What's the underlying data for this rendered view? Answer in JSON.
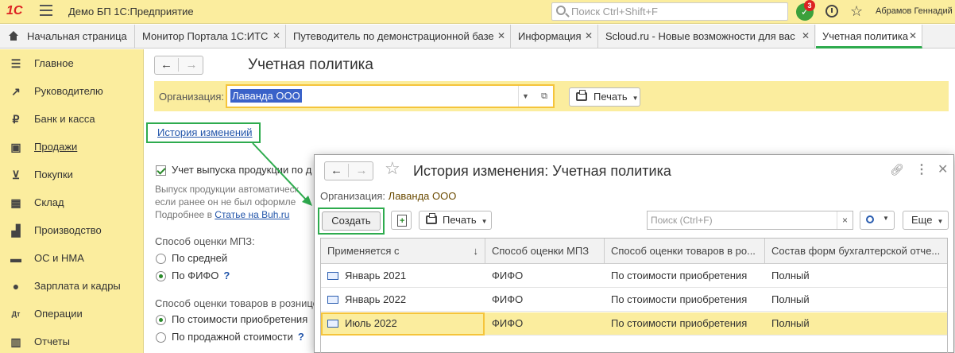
{
  "topbar": {
    "logo": "1С",
    "title": "Демо БП 1С:Предприятие",
    "search_placeholder": "Поиск Ctrl+Shift+F",
    "notif_count": "3",
    "user": "Абрамов Геннадий"
  },
  "tabs": [
    {
      "label": "Начальная страница"
    },
    {
      "label": "Монитор Портала 1С:ИТС"
    },
    {
      "label": "Путеводитель по демонстрационной базе"
    },
    {
      "label": "Информация"
    },
    {
      "label": "Scloud.ru - Новые возможности для вас"
    },
    {
      "label": "Учетная политика"
    }
  ],
  "sidebar": {
    "items": [
      {
        "label": "Главное",
        "icon": "menu-icon"
      },
      {
        "label": "Руководителю",
        "icon": "chart-icon"
      },
      {
        "label": "Банк и касса",
        "icon": "ruble-icon"
      },
      {
        "label": "Продажи",
        "icon": "bag-icon"
      },
      {
        "label": "Покупки",
        "icon": "cart-icon"
      },
      {
        "label": "Склад",
        "icon": "warehouse-icon"
      },
      {
        "label": "Производство",
        "icon": "factory-icon"
      },
      {
        "label": "ОС и НМА",
        "icon": "truck-icon"
      },
      {
        "label": "Зарплата и кадры",
        "icon": "person-icon"
      },
      {
        "label": "Операции",
        "icon": "dt-kt-icon"
      },
      {
        "label": "Отчеты",
        "icon": "report-icon"
      }
    ]
  },
  "main": {
    "title": "Учетная политика",
    "org_label": "Организация:",
    "org_value": "Лаванда ООО",
    "print_label": "Печать",
    "history_link": "История изменений",
    "checkbox_label": "Учет выпуска продукции по д",
    "desc_line1": "Выпуск продукции автоматическ",
    "desc_line2": "если ранее он не был оформле",
    "desc_line3_prefix": "Подробнее в ",
    "desc_line3_link": "Статье на Buh.ru",
    "mpz_label": "Способ оценки МПЗ:",
    "mpz_opt1": "По средней",
    "mpz_opt2": "По ФИФО",
    "qmark": "?",
    "retail_label": "Способ оценки товаров в рознице",
    "retail_opt1": "По стоимости приобретения",
    "retail_opt2": "По продажной стоимости"
  },
  "dialog": {
    "title": "История изменения: Учетная политика",
    "org_label": "Организация:",
    "org_value": "Лаванда ООО",
    "create_label": "Создать",
    "print_label": "Печать",
    "search_placeholder": "Поиск (Ctrl+F)",
    "more_label": "Еще",
    "columns": [
      "Применяется с",
      "Способ оценки МПЗ",
      "Способ оценки товаров в ро...",
      "Состав форм бухгалтерской отче..."
    ],
    "sort_indicator": "↓",
    "rows": [
      {
        "date": "Январь 2021",
        "mpz": "ФИФО",
        "retail": "По стоимости приобретения",
        "forms": "Полный"
      },
      {
        "date": "Январь 2022",
        "mpz": "ФИФО",
        "retail": "По стоимости приобретения",
        "forms": "Полный"
      },
      {
        "date": "Июль 2022",
        "mpz": "ФИФО",
        "retail": "По стоимости приобретения",
        "forms": "Полный"
      }
    ]
  }
}
